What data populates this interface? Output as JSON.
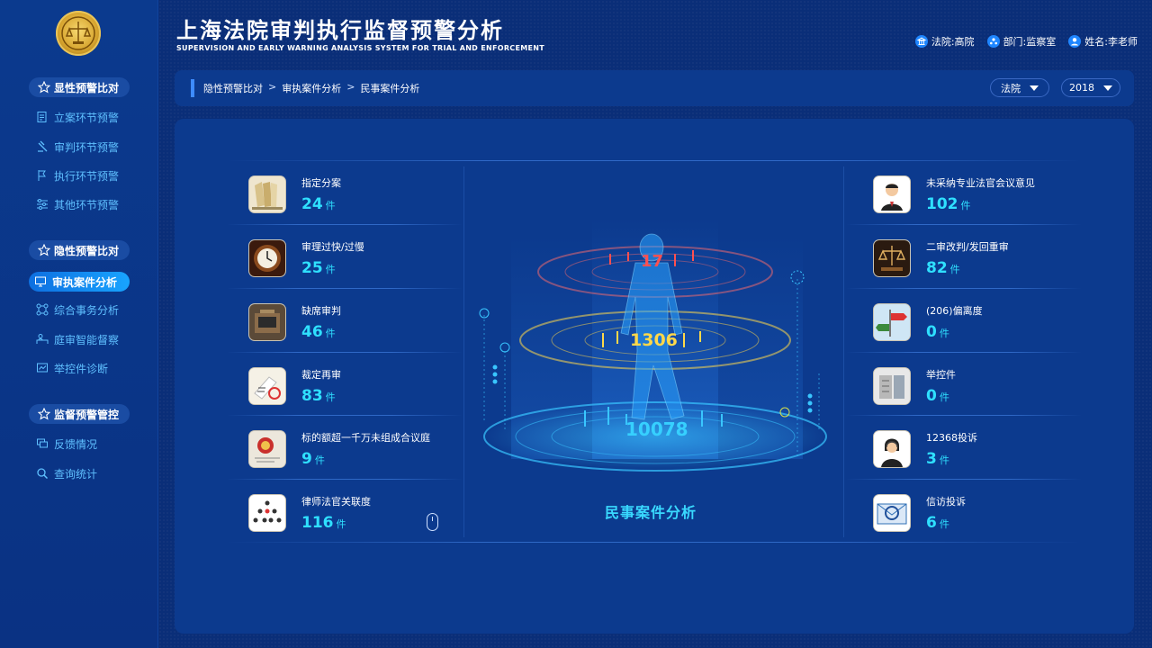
{
  "header": {
    "title": "上海法院审判执行监督预警分析",
    "subtitle": "SUPERVISION AND EARLY WARNING ANALYSIS SYSTEM FOR TRIAL AND ENFORCEMENT",
    "court": "法院:高院",
    "department": "部门:监察室",
    "name": "姓名:李老师"
  },
  "sidebar": {
    "groups": [
      {
        "label": "显性预警比对",
        "items": [
          "立案环节预警",
          "审判环节预警",
          "执行环节预警",
          "其他环节预警"
        ]
      },
      {
        "label": "隐性预警比对",
        "items": [
          "审执案件分析",
          "综合事务分析",
          "庭审智能督察",
          "举控件诊断"
        ]
      },
      {
        "label": "监督预警管控",
        "items": [
          "反馈情况",
          "查询统计"
        ]
      }
    ],
    "active_item": "审执案件分析"
  },
  "breadcrumb": [
    "隐性预警比对",
    "审执案件分析",
    "民事案件分析"
  ],
  "breadcrumb_sep": ">",
  "filters": {
    "court": "法院",
    "year": "2018"
  },
  "left_stats": [
    {
      "label": "指定分案",
      "value": "24",
      "unit": "件"
    },
    {
      "label": "审理过快/过慢",
      "value": "25",
      "unit": "件"
    },
    {
      "label": "缺席审判",
      "value": "46",
      "unit": "件"
    },
    {
      "label": "裁定再审",
      "value": "83",
      "unit": "件"
    },
    {
      "label": "标的额超一千万未组成合议庭",
      "value": "9",
      "unit": "件"
    },
    {
      "label": "律师法官关联度",
      "value": "116",
      "unit": "件"
    }
  ],
  "right_stats": [
    {
      "label": "未采纳专业法官会议意见",
      "value": "102",
      "unit": "件"
    },
    {
      "label": "二审改判/发回重审",
      "value": "82",
      "unit": "件"
    },
    {
      "label": "(206)偏离度",
      "value": "0",
      "unit": "件"
    },
    {
      "label": "举控件",
      "value": "0",
      "unit": "件"
    },
    {
      "label": "12368投诉",
      "value": "3",
      "unit": "件"
    },
    {
      "label": "信访投诉",
      "value": "6",
      "unit": "件"
    }
  ],
  "center": {
    "top_value": "17",
    "mid_value": "1306",
    "bottom_value": "10078",
    "title": "民事案件分析"
  },
  "colors": {
    "cyan": "#2fe0ff",
    "red": "#ff5050",
    "yellow": "#ffd84a",
    "accent": "#18a4ff"
  }
}
